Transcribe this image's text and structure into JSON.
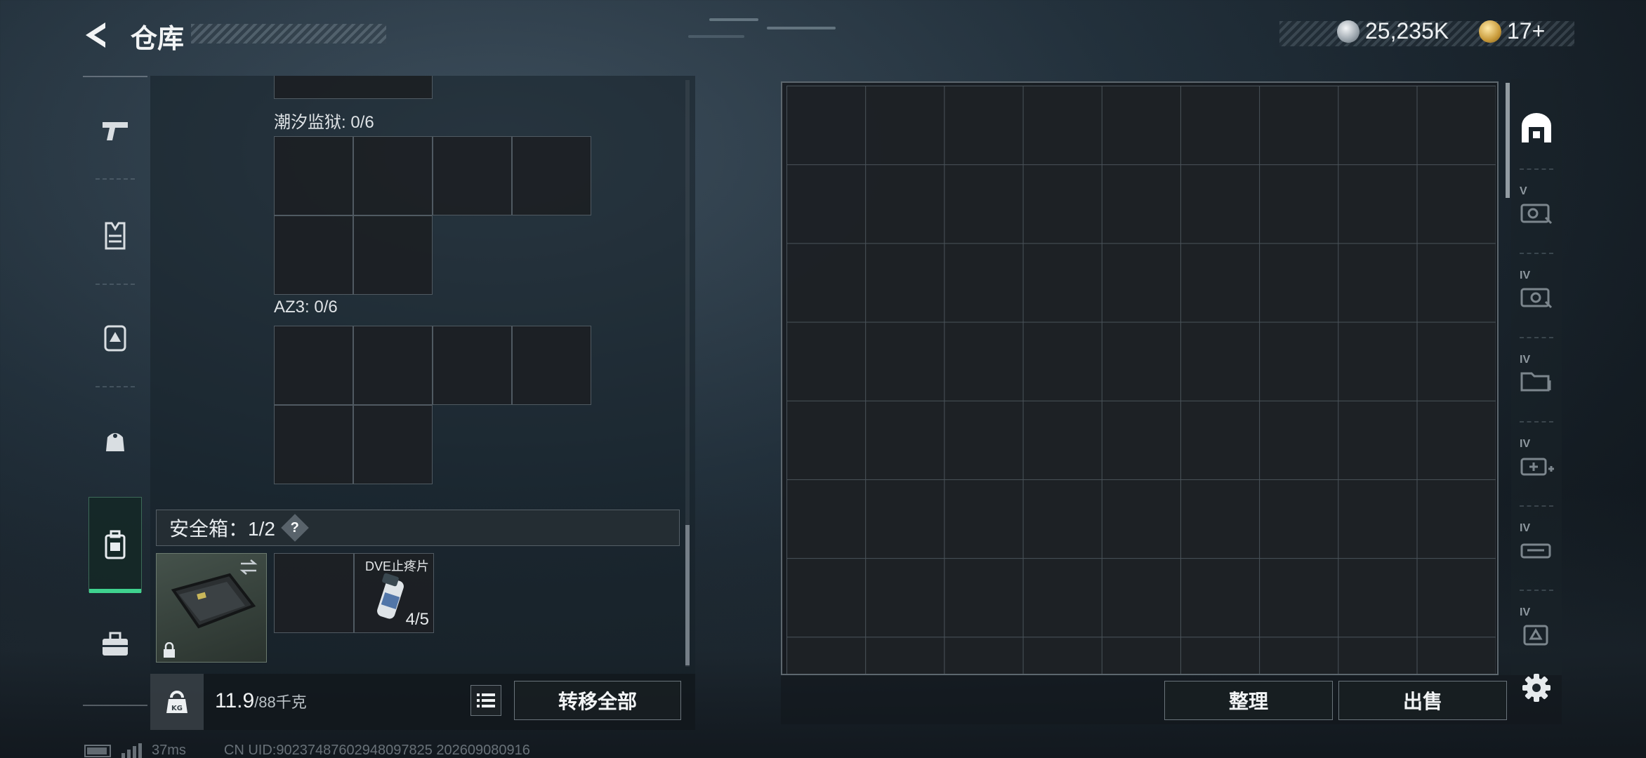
{
  "header": {
    "title": "仓库",
    "currency_silver": "25,235K",
    "currency_gold": "17+"
  },
  "left_nav": {
    "items": [
      {
        "icon": "pistol-icon"
      },
      {
        "icon": "vest-icon"
      },
      {
        "icon": "backpack-icon"
      },
      {
        "icon": "pouch-icon"
      },
      {
        "icon": "safe-case-icon",
        "active": true
      },
      {
        "icon": "toolbox-icon"
      }
    ]
  },
  "container": {
    "slots": [
      {
        "label": "潮汐监狱: 0/6"
      },
      {
        "label": "AZ3: 0/6"
      }
    ],
    "safe_box": {
      "label": "安全箱：1/2",
      "help": "?"
    },
    "items": [
      {
        "name": "DVE止疼片",
        "count": "4/5"
      }
    ]
  },
  "bottom_bar": {
    "weight_current": "11.9",
    "weight_capacity": "/88千克",
    "weight_icon_text": "KG",
    "transfer_all": "转移全部"
  },
  "stash": {
    "columns": 9,
    "rows": 8
  },
  "right_nav": {
    "items": [
      {
        "icon": "warehouse-icon",
        "tier": ""
      },
      {
        "icon": "camera-case-icon",
        "tier": "V"
      },
      {
        "icon": "camera-case-icon",
        "tier": "IV"
      },
      {
        "icon": "folder-case-icon",
        "tier": "IV"
      },
      {
        "icon": "medkit-case-icon",
        "tier": "IV"
      },
      {
        "icon": "gun-case-icon",
        "tier": "IV"
      },
      {
        "icon": "backpack-case-icon",
        "tier": "IV"
      }
    ]
  },
  "actions": {
    "sort": "整理",
    "sell": "出售"
  },
  "status": {
    "ping": "37ms",
    "uid": "CN UID:90237487602948097825 202609080916"
  },
  "colors": {
    "accent_green": "#3fd28f",
    "grid_line": "#4a535a",
    "panel_bg": "#16202a"
  }
}
